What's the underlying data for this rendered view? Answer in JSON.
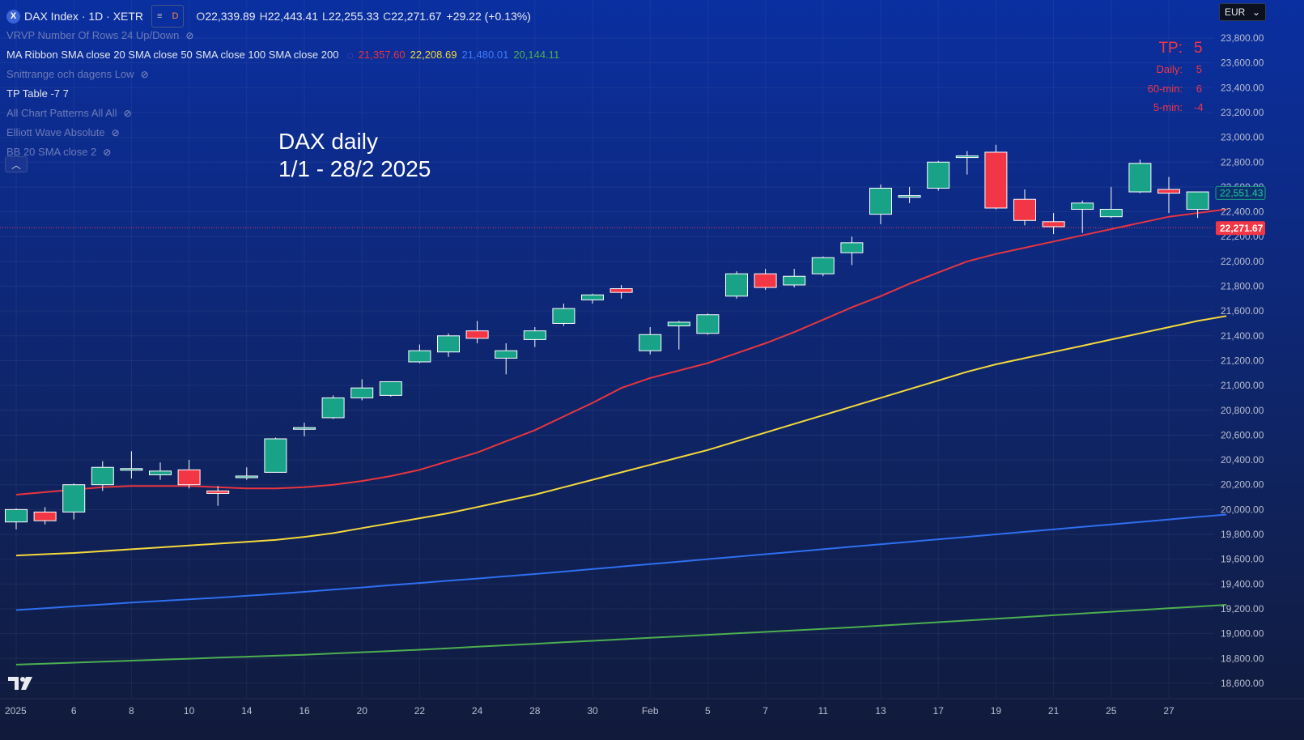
{
  "header": {
    "symbol_logo": "X",
    "symbol": "DAX Index · 1D · XETR",
    "badge_dot": "≡",
    "badge_d": "D",
    "ohlc": {
      "o_label": "O",
      "o": "22,339.89",
      "h_label": "H",
      "h": "22,443.41",
      "l_label": "L",
      "l": "22,255.33",
      "c_label": "C",
      "c": "22,271.67",
      "change": "+29.22 (+0.13%)"
    }
  },
  "indicators": [
    {
      "label": "VRVP Number Of Rows 24 Up/Down",
      "hidden": true
    },
    {
      "label": "MA Ribbon SMA close 20 SMA close 50 SMA close 100 SMA close 200",
      "hidden": false,
      "values": [
        "21,357.60",
        "22,208.69",
        "21,480.01",
        "20,144.11"
      ]
    },
    {
      "label": "Snittrange och dagens Low",
      "hidden": true
    },
    {
      "label": "TP Table -7 7",
      "hidden": false
    },
    {
      "label": "All Chart Patterns All All",
      "hidden": true
    },
    {
      "label": "Elliott Wave Absolute",
      "hidden": true
    },
    {
      "label": "BB 20 SMA close 2",
      "hidden": true
    }
  ],
  "annotation": {
    "line1": "DAX daily",
    "line2": "1/1 - 28/2 2025"
  },
  "tp_table": {
    "title": "TP:",
    "title_value": "5",
    "rows": [
      {
        "label": "Daily:",
        "value": "5"
      },
      {
        "label": "60-min:",
        "value": "6"
      },
      {
        "label": "5-min:",
        "value": "-4"
      }
    ]
  },
  "currency": "EUR",
  "colors": {
    "up": "#18a388",
    "down": "#f23645",
    "ma20": "#e8353f",
    "ma50": "#f5d93c",
    "ma100": "#2f6ff0",
    "ma200": "#4caf50",
    "price_line": "#f23645"
  },
  "chart_data": {
    "type": "candlestick",
    "y_ticks": [
      "23,800.00",
      "23,600.00",
      "23,400.00",
      "23,200.00",
      "23,000.00",
      "22,800.00",
      "22,600.00",
      "22,400.00",
      "22,200.00",
      "22,000.00",
      "21,800.00",
      "21,600.00",
      "21,400.00",
      "21,200.00",
      "21,000.00",
      "20,800.00",
      "20,600.00",
      "20,400.00",
      "20,200.00",
      "20,000.00",
      "19,800.00",
      "19,600.00",
      "19,400.00",
      "19,200.00",
      "19,000.00",
      "18,800.00",
      "18,600.00"
    ],
    "y_tick_values": [
      23800,
      23600,
      23400,
      23200,
      23000,
      22800,
      22600,
      22400,
      22200,
      22000,
      21800,
      21600,
      21400,
      21200,
      21000,
      20800,
      20600,
      20400,
      20200,
      20000,
      19800,
      19600,
      19400,
      19200,
      19000,
      18800,
      18600
    ],
    "x_labels": [
      {
        "index": 0,
        "label": "2025"
      },
      {
        "index": 2,
        "label": "6"
      },
      {
        "index": 4,
        "label": "8"
      },
      {
        "index": 6,
        "label": "10"
      },
      {
        "index": 8,
        "label": "14"
      },
      {
        "index": 10,
        "label": "16"
      },
      {
        "index": 12,
        "label": "20"
      },
      {
        "index": 14,
        "label": "22"
      },
      {
        "index": 16,
        "label": "24"
      },
      {
        "index": 18,
        "label": "28"
      },
      {
        "index": 20,
        "label": "30"
      },
      {
        "index": 22,
        "label": "Feb"
      },
      {
        "index": 24,
        "label": "5"
      },
      {
        "index": 26,
        "label": "7"
      },
      {
        "index": 28,
        "label": "11"
      },
      {
        "index": 30,
        "label": "13"
      },
      {
        "index": 32,
        "label": "17"
      },
      {
        "index": 34,
        "label": "19"
      },
      {
        "index": 36,
        "label": "21"
      },
      {
        "index": 38,
        "label": "25"
      },
      {
        "index": 40,
        "label": "27"
      }
    ],
    "ohlc": [
      [
        19900,
        20010,
        19840,
        20000
      ],
      [
        19980,
        20020,
        19880,
        19910
      ],
      [
        19980,
        20210,
        19920,
        20200
      ],
      [
        20200,
        20390,
        20150,
        20340
      ],
      [
        20330,
        20470,
        20250,
        20330
      ],
      [
        20280,
        20380,
        20240,
        20310
      ],
      [
        20320,
        20400,
        20170,
        20200
      ],
      [
        20150,
        20190,
        20030,
        20130
      ],
      [
        20260,
        20340,
        20240,
        20270
      ],
      [
        20300,
        20580,
        20300,
        20570
      ],
      [
        20650,
        20700,
        20590,
        20660
      ],
      [
        20740,
        20920,
        20730,
        20900
      ],
      [
        20900,
        21050,
        20880,
        20980
      ],
      [
        20920,
        21030,
        20910,
        21030
      ],
      [
        21190,
        21330,
        21180,
        21280
      ],
      [
        21270,
        21420,
        21230,
        21400
      ],
      [
        21440,
        21520,
        21340,
        21380
      ],
      [
        21220,
        21340,
        21090,
        21280
      ],
      [
        21370,
        21470,
        21310,
        21440
      ],
      [
        21500,
        21660,
        21480,
        21620
      ],
      [
        21690,
        21740,
        21660,
        21730
      ],
      [
        21780,
        21810,
        21700,
        21750
      ],
      [
        21280,
        21470,
        21250,
        21410
      ],
      [
        21480,
        21520,
        21290,
        21510
      ],
      [
        21420,
        21580,
        21410,
        21570
      ],
      [
        21720,
        21920,
        21700,
        21900
      ],
      [
        21900,
        21940,
        21770,
        21790
      ],
      [
        21810,
        21940,
        21790,
        21880
      ],
      [
        21900,
        22040,
        21880,
        22030
      ],
      [
        22070,
        22200,
        21970,
        22150
      ],
      [
        22380,
        22620,
        22300,
        22590
      ],
      [
        22520,
        22600,
        22470,
        22530
      ],
      [
        22590,
        22810,
        22570,
        22800
      ],
      [
        22840,
        22890,
        22700,
        22850
      ],
      [
        22880,
        22940,
        22420,
        22430
      ],
      [
        22500,
        22580,
        22290,
        22330
      ],
      [
        22320,
        22390,
        22220,
        22280
      ],
      [
        22420,
        22490,
        22230,
        22470
      ],
      [
        22360,
        22600,
        22350,
        22420
      ],
      [
        22560,
        22820,
        22550,
        22790
      ],
      [
        22580,
        22680,
        22390,
        22550
      ],
      [
        22420,
        22560,
        22350,
        22560
      ]
    ],
    "ma20": [
      20120,
      20140,
      20160,
      20180,
      20190,
      20190,
      20190,
      20180,
      20170,
      20170,
      20180,
      20200,
      20230,
      20270,
      20320,
      20390,
      20460,
      20550,
      20640,
      20750,
      20860,
      20980,
      21060,
      21120,
      21180,
      21260,
      21340,
      21430,
      21530,
      21630,
      21720,
      21820,
      21910,
      22000,
      22060,
      22110,
      22160,
      22210,
      22260,
      22310,
      22360,
      22390,
      22420
    ],
    "ma50": [
      19630,
      19640,
      19650,
      19665,
      19680,
      19695,
      19710,
      19725,
      19740,
      19755,
      19780,
      19810,
      19850,
      19890,
      19930,
      19970,
      20020,
      20070,
      20120,
      20180,
      20240,
      20300,
      20360,
      20420,
      20480,
      20550,
      20620,
      20690,
      20760,
      20830,
      20900,
      20970,
      21040,
      21110,
      21170,
      21220,
      21270,
      21320,
      21370,
      21420,
      21470,
      21520,
      21560
    ],
    "ma100": [
      19190,
      19205,
      19220,
      19235,
      19250,
      19263,
      19276,
      19290,
      19305,
      19320,
      19337,
      19354,
      19372,
      19390,
      19408,
      19426,
      19444,
      19462,
      19480,
      19500,
      19520,
      19540,
      19560,
      19580,
      19600,
      19620,
      19640,
      19660,
      19680,
      19700,
      19720,
      19740,
      19760,
      19780,
      19800,
      19820,
      19840,
      19860,
      19880,
      19900,
      19920,
      19940,
      19960
    ],
    "ma200": [
      18750,
      18758,
      18766,
      18774,
      18782,
      18790,
      18798,
      18806,
      18814,
      18822,
      18830,
      18840,
      18850,
      18860,
      18870,
      18882,
      18894,
      18906,
      18918,
      18930,
      18942,
      18954,
      18966,
      18978,
      18990,
      19002,
      19014,
      19026,
      19038,
      19050,
      19064,
      19078,
      19092,
      19106,
      19120,
      19134,
      19148,
      19162,
      19176,
      19190,
      19204,
      19218,
      19232
    ],
    "last_price_label": "22,271.67",
    "last_price": 22271.67,
    "bb_label": "22,551.43",
    "bb_value": 22551.43
  }
}
